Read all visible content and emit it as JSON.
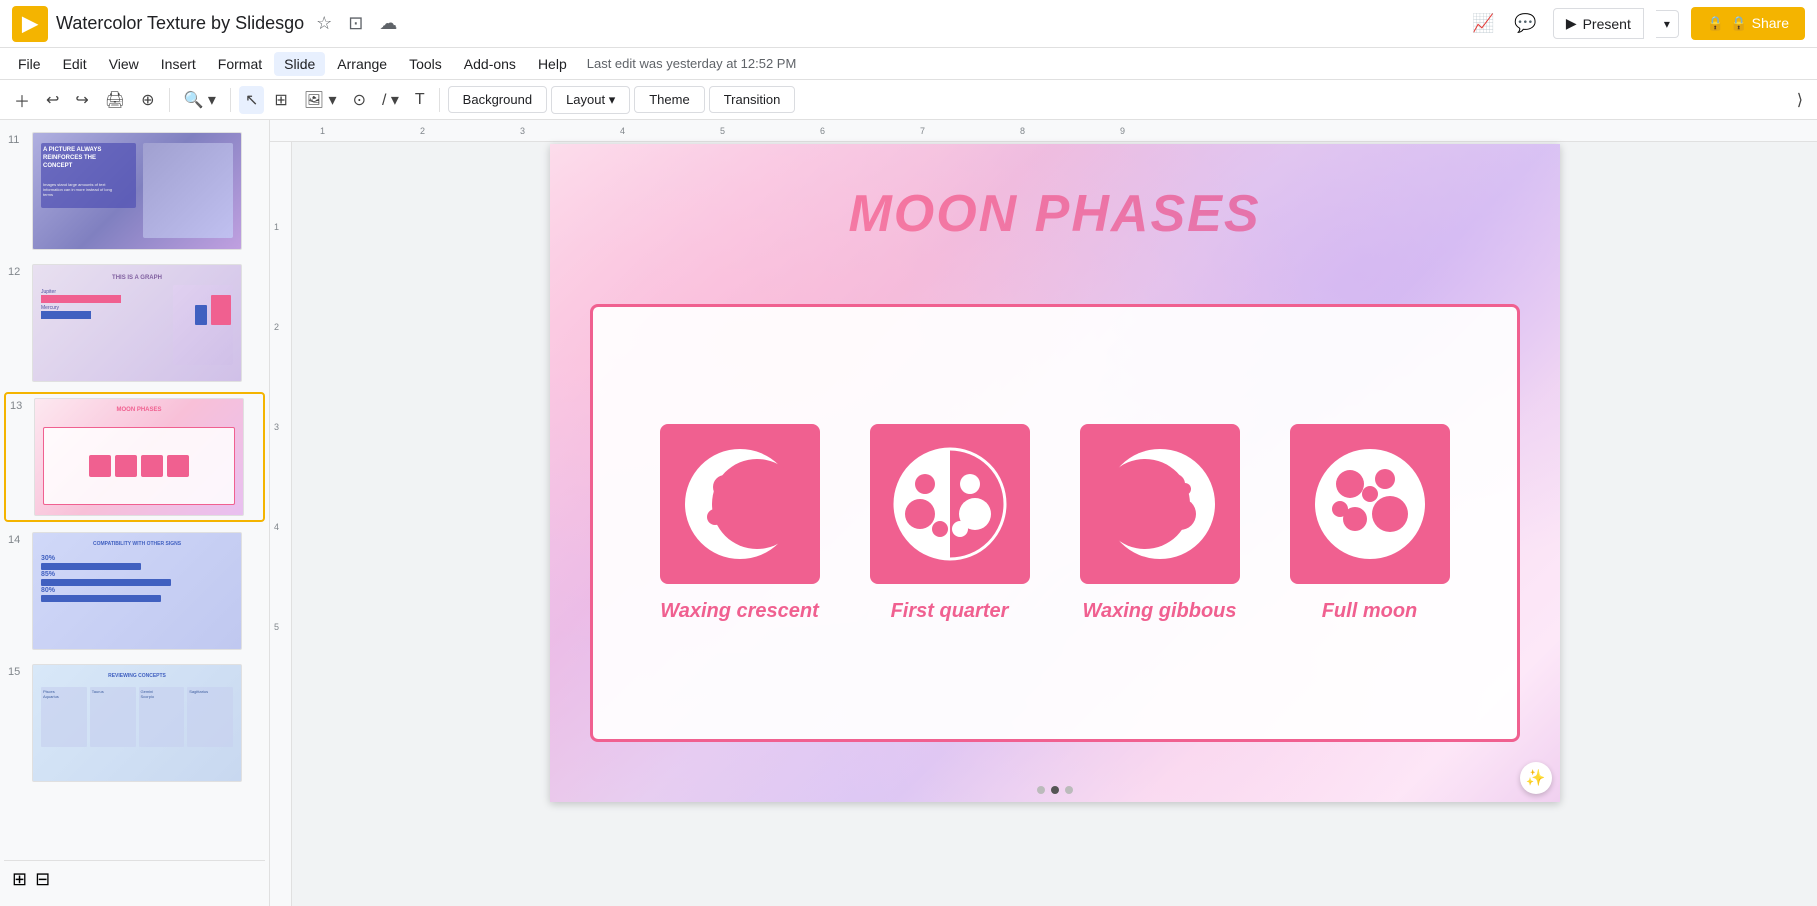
{
  "app": {
    "icon": "▶",
    "title": "Watercolor Texture by Slidesgo",
    "last_edit": "Last edit was yesterday at 12:52 PM"
  },
  "header": {
    "star_icon": "☆",
    "folder_icon": "⊡",
    "cloud_icon": "☁",
    "stats_icon": "⟋",
    "comment_icon": "💬",
    "present_label": "Present",
    "share_label": "🔒 Share"
  },
  "menu": {
    "items": [
      "File",
      "Edit",
      "View",
      "Insert",
      "Format",
      "Slide",
      "Arrange",
      "Tools",
      "Add-ons",
      "Help"
    ]
  },
  "toolbar": {
    "add_slide": "+",
    "undo": "↩",
    "redo": "↪",
    "print": "🖨",
    "paint_format": "⊕",
    "zoom": "🔍",
    "select": "↖",
    "edit_box": "⊞",
    "image": "🖼",
    "shapes": "⊙",
    "line": "/",
    "text": "T",
    "background_label": "Background",
    "layout_label": "Layout",
    "theme_label": "Theme",
    "transition_label": "Transition"
  },
  "slides": [
    {
      "num": "11",
      "type": "purple-gradient"
    },
    {
      "num": "12",
      "type": "graph"
    },
    {
      "num": "13",
      "type": "moon-phases",
      "active": true
    },
    {
      "num": "14",
      "type": "compatibility"
    },
    {
      "num": "15",
      "type": "reviewing"
    }
  ],
  "slide": {
    "title": "MOON PHASES",
    "phases": [
      {
        "label": "Waxing crescent",
        "id": "waxing-crescent"
      },
      {
        "label": "First quarter",
        "id": "first-quarter"
      },
      {
        "label": "Waxing gibbous",
        "id": "waxing-gibbous"
      },
      {
        "label": "Full moon",
        "id": "full-moon"
      }
    ]
  },
  "colors": {
    "accent": "#f06090",
    "title_color": "#f06090",
    "card_border": "#f06090",
    "phase_bg": "#f06090",
    "phase_text": "#f06090"
  }
}
